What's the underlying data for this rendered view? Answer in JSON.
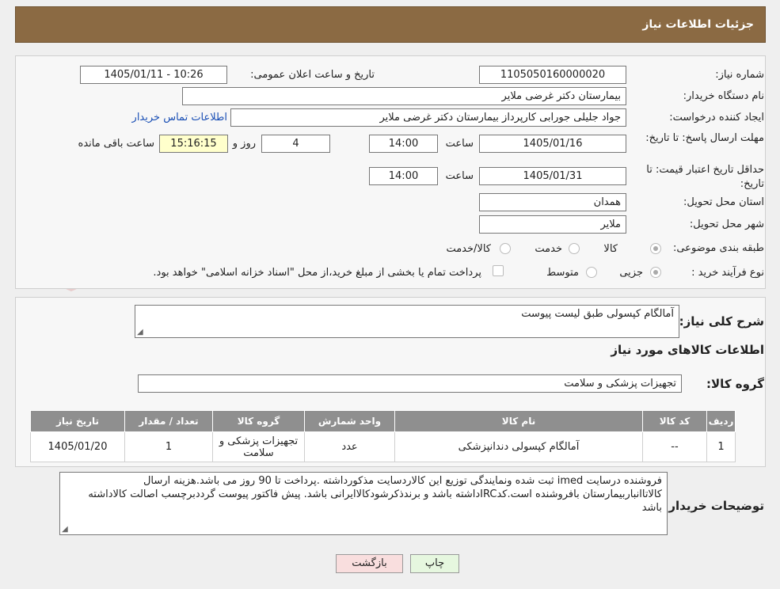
{
  "header": {
    "title": "جزئیات اطلاعات نیاز"
  },
  "form": {
    "need_number": {
      "label": "شماره نیاز:",
      "value": "1105050160000020"
    },
    "announce_datetime": {
      "label": "تاریخ و ساعت اعلان عمومی:",
      "value": "1405/01/11 - 10:26"
    },
    "buyer_org": {
      "label": "نام دستگاه خریدار:",
      "value": "بیمارستان دکتر غرضی ملایر"
    },
    "requester": {
      "label": "ایجاد کننده درخواست:",
      "value": "جواد جلیلی جورابی کارپرداز بیمارستان دکتر غرضی ملایر"
    },
    "buyer_contact_link": "اطلاعات تماس خریدار",
    "reply_deadline": {
      "label": "مهلت ارسال پاسخ: تا تاریخ:",
      "date": "1405/01/16",
      "time_label": "ساعت",
      "time": "14:00",
      "days": "4",
      "days_label": "روز و",
      "remaining": "15:16:15",
      "remaining_label": "ساعت باقی مانده"
    },
    "price_validity": {
      "label": "حداقل تاریخ اعتبار قیمت: تا تاریخ:",
      "date": "1405/01/31",
      "time_label": "ساعت",
      "time": "14:00"
    },
    "province": {
      "label": "استان محل تحویل:",
      "value": "همدان"
    },
    "city": {
      "label": "شهر محل تحویل:",
      "value": "ملایر"
    },
    "category": {
      "label": "طبقه بندی موضوعی:",
      "options": [
        "کالا",
        "خدمت",
        "کالا/خدمت"
      ],
      "selected": "کالا"
    },
    "process": {
      "label": "نوع فرآیند خرید :",
      "options": [
        "جزیی",
        "متوسط"
      ],
      "selected": "جزیی",
      "payment_note": "پرداخت تمام یا بخشی از مبلغ خرید،از محل \"اسناد خزانه اسلامی\" خواهد بود."
    }
  },
  "summary": {
    "label": "شرح کلی نیاز:",
    "value": "آمالگام کپسولی طبق لیست پیوست",
    "items_heading": "اطلاعات کالاهای مورد نیاز",
    "group_label": "گروه کالا:",
    "group_value": "تجهیزات پزشکی و سلامت"
  },
  "table": {
    "headers": [
      "ردیف",
      "کد کالا",
      "نام کالا",
      "واحد شمارش",
      "گروه کالا",
      "تعداد / مقدار",
      "تاریخ نیاز"
    ],
    "rows": [
      [
        "1",
        "--",
        "آمالگام کپسولی دندانپزشکی",
        "عدد",
        "تجهیزات پزشکی و سلامت",
        "1",
        "1405/01/20"
      ]
    ]
  },
  "buyer_notes": {
    "label": "توضیحات خریدار:",
    "value": "فروشنده درسایت imed ثبت شده ونمایندگی توزیع این کالاردسایت مذکورداشته .پرداخت تا  90 روز می باشد.هزینه ارسال کالاتاانباربیمارستان بافروشنده است.کدIRCداشته باشد و برندذکرشودکالاایرانی باشد. پیش فاکتور پیوست گرددبرچسب اصالت کالاداشته باشد"
  },
  "buttons": {
    "print": "چاپ",
    "back": "بازگشت"
  },
  "watermark": {
    "text": "AriaTender.neT"
  },
  "colors": {
    "header_bg": "#8b6a43",
    "table_header_bg": "#8f8f8f",
    "print_btn": "#e6f7df",
    "back_btn": "#f9dede"
  }
}
